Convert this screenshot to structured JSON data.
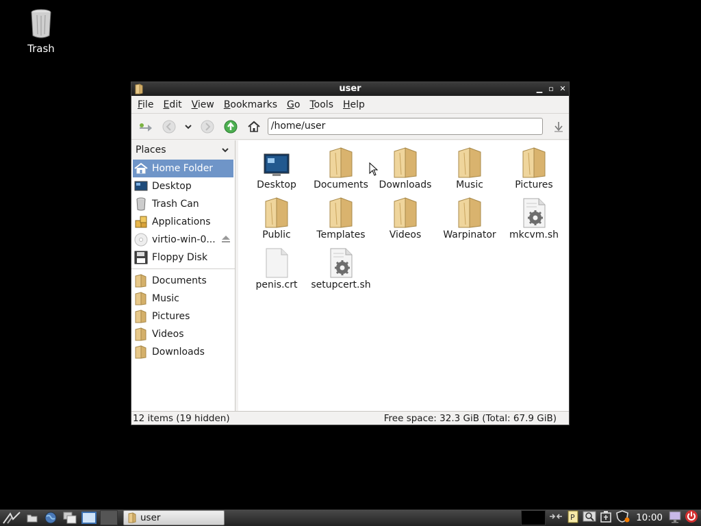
{
  "desktop": {
    "trash_label": "Trash"
  },
  "window": {
    "title": "user",
    "controls": [
      "minimize-icon",
      "maximize-icon",
      "close-icon"
    ]
  },
  "menubar": [
    "File",
    "Edit",
    "View",
    "Bookmarks",
    "Go",
    "Tools",
    "Help"
  ],
  "toolbar": {
    "address": "/home/user"
  },
  "sidebar": {
    "header": "Places",
    "items": [
      {
        "label": "Home Folder",
        "icon": "home-icon",
        "selected": true
      },
      {
        "label": "Desktop",
        "icon": "desktop-icon"
      },
      {
        "label": "Trash Can",
        "icon": "trash-icon"
      },
      {
        "label": "Applications",
        "icon": "applications-icon"
      },
      {
        "label": "virtio-win-0...",
        "icon": "cdrom-icon",
        "eject": true
      },
      {
        "label": "Floppy Disk",
        "icon": "floppy-icon"
      }
    ],
    "bookmarks": [
      {
        "label": "Documents",
        "icon": "folder-icon"
      },
      {
        "label": "Music",
        "icon": "folder-icon"
      },
      {
        "label": "Pictures",
        "icon": "folder-icon"
      },
      {
        "label": "Videos",
        "icon": "folder-icon"
      },
      {
        "label": "Downloads",
        "icon": "folder-icon"
      }
    ]
  },
  "files": [
    {
      "name": "Desktop",
      "icon": "desktop-icon"
    },
    {
      "name": "Documents",
      "icon": "folder-icon"
    },
    {
      "name": "Downloads",
      "icon": "folder-icon"
    },
    {
      "name": "Music",
      "icon": "folder-icon"
    },
    {
      "name": "Pictures",
      "icon": "folder-icon"
    },
    {
      "name": "Public",
      "icon": "folder-icon"
    },
    {
      "name": "Templates",
      "icon": "folder-icon"
    },
    {
      "name": "Videos",
      "icon": "folder-icon"
    },
    {
      "name": "Warpinator",
      "icon": "folder-icon"
    },
    {
      "name": "mkcvm.sh",
      "icon": "script-icon"
    },
    {
      "name": "penis.crt",
      "icon": "file-icon"
    },
    {
      "name": "setupcert.sh",
      "icon": "script-icon"
    }
  ],
  "status": {
    "left": "12 items (19 hidden)",
    "right": "Free space: 32.3 GiB (Total: 67.9 GiB)"
  },
  "taskbar": {
    "window_label": "user",
    "clock": "10:00"
  },
  "colors": {
    "selection": "#6f95c8",
    "folder": "#e8c98a",
    "go_up": "#4caf50"
  }
}
